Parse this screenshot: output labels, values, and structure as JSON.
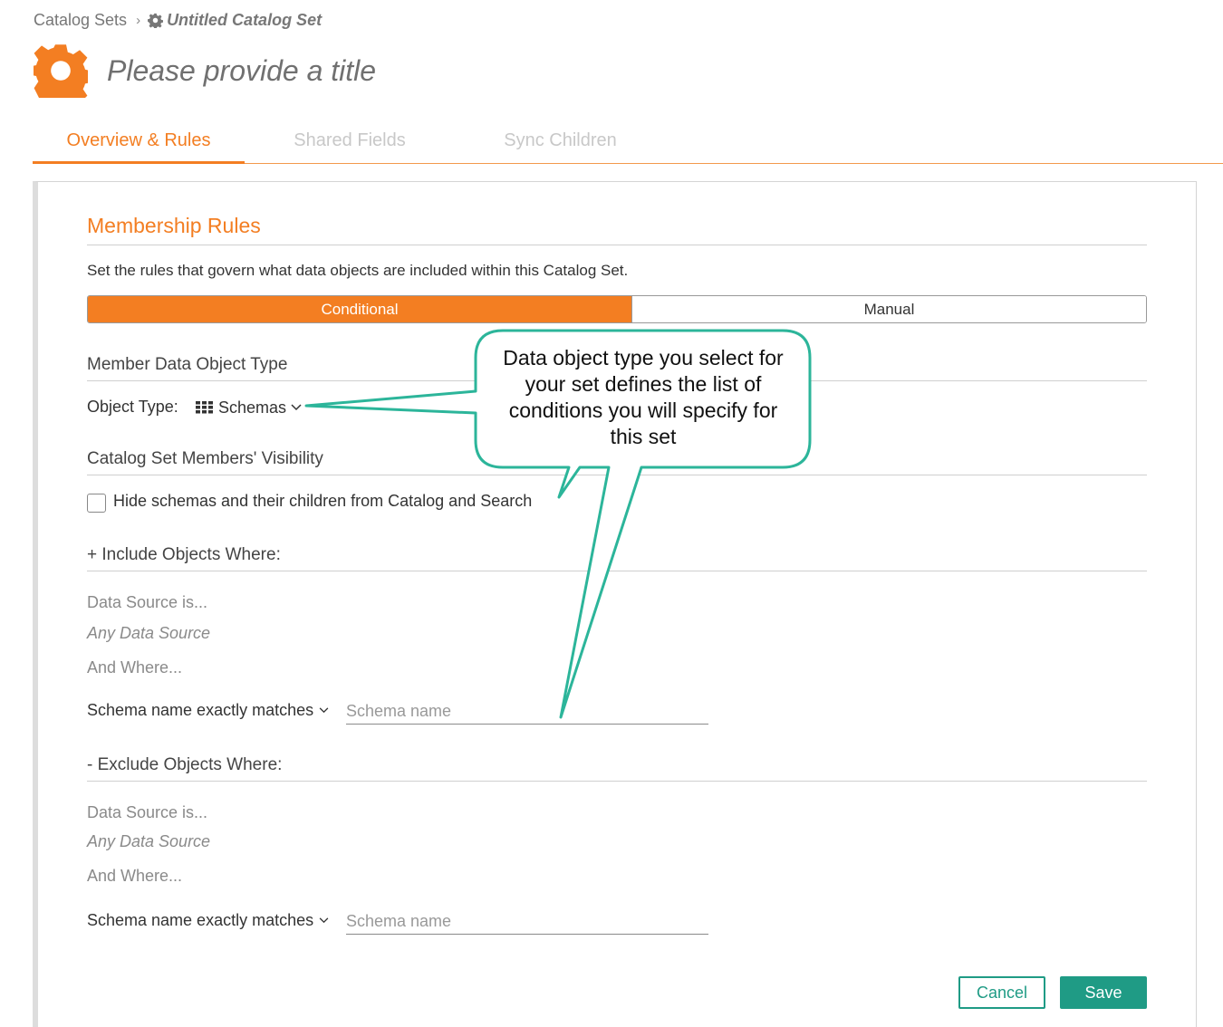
{
  "breadcrumb": {
    "parent": "Catalog Sets",
    "current": "Untitled Catalog Set"
  },
  "header": {
    "title": "Please provide a title",
    "icon": "gear-icon",
    "accent_color": "#f37e22"
  },
  "tabs": [
    {
      "label": "Overview & Rules",
      "active": true
    },
    {
      "label": "Shared Fields",
      "active": false
    },
    {
      "label": "Sync Children",
      "active": false
    }
  ],
  "membership": {
    "title": "Membership Rules",
    "description": "Set the rules that govern what data objects are included within this Catalog Set.",
    "mode_options": [
      "Conditional",
      "Manual"
    ],
    "selected_mode": "Conditional"
  },
  "member_type": {
    "heading": "Member Data Object Type",
    "label": "Object Type:",
    "value": "Schemas"
  },
  "visibility": {
    "heading": "Catalog Set Members' Visibility",
    "checkbox_label": "Hide schemas and their children from Catalog and Search",
    "checked": false
  },
  "include": {
    "heading": "+ Include Objects Where:",
    "data_source_label": "Data Source is...",
    "data_source_value": "Any Data Source",
    "and_where": "And Where...",
    "condition": "Schema name exactly matches",
    "input_placeholder": "Schema name"
  },
  "exclude": {
    "heading": "- Exclude Objects Where:",
    "data_source_label": "Data Source is...",
    "data_source_value": "Any Data Source",
    "and_where": "And Where...",
    "condition": "Schema name exactly matches",
    "input_placeholder": "Schema name"
  },
  "buttons": {
    "cancel": "Cancel",
    "save": "Save",
    "primary_color": "#1f9b85"
  },
  "callout": {
    "text": "Data object type you select for\nyour set defines the list of\nconditions you will specify for\nthis set",
    "border_color": "#2cb59a"
  }
}
